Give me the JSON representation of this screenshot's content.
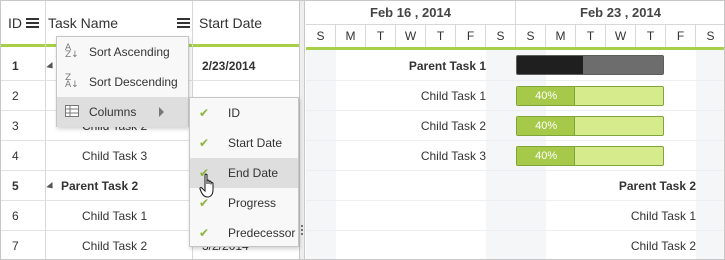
{
  "grid": {
    "columns": {
      "id": "ID",
      "task_name": "Task Name",
      "start_date": "Start Date"
    },
    "rows": [
      {
        "id": "1",
        "name": "",
        "start": "2/23/2014",
        "bold": true
      },
      {
        "id": "2",
        "name": "",
        "start": "",
        "bold": false
      },
      {
        "id": "3",
        "name": "Child Task 2",
        "start": "",
        "bold": false
      },
      {
        "id": "4",
        "name": "Child Task 3",
        "start": "",
        "bold": false
      },
      {
        "id": "5",
        "name": "Parent Task 2",
        "start": "",
        "bold": true
      },
      {
        "id": "6",
        "name": "Child Task 1",
        "start": "",
        "bold": false
      },
      {
        "id": "7",
        "name": "Child Task 2",
        "start": "3/2/2014",
        "bold": false
      }
    ]
  },
  "context_menu": {
    "items": [
      {
        "label": "Sort Ascending",
        "icon": "sort-ascending-icon"
      },
      {
        "label": "Sort Descending",
        "icon": "sort-descending-icon"
      },
      {
        "label": "Columns",
        "icon": "columns-icon"
      }
    ]
  },
  "columns_submenu": {
    "items": [
      {
        "label": "ID",
        "checked": true
      },
      {
        "label": "Start Date",
        "checked": true
      },
      {
        "label": "End Date",
        "checked": true
      },
      {
        "label": "Progress",
        "checked": true
      },
      {
        "label": "Predecessor",
        "checked": true
      }
    ]
  },
  "timeline": {
    "weeks": [
      "Feb 16 , 2014",
      "Feb 23 , 2014"
    ],
    "days": [
      "S",
      "M",
      "T",
      "W",
      "T",
      "F",
      "S",
      "S",
      "M",
      "T",
      "W",
      "T",
      "F",
      "S"
    ]
  },
  "chart_rows": [
    {
      "label": "Parent Task 1",
      "bold": true,
      "bar": "parent",
      "progress": 0.45
    },
    {
      "label": "Child Task 1",
      "bold": false,
      "bar": "task",
      "progress": 0.4,
      "progress_text": "40%"
    },
    {
      "label": "Child Task 2",
      "bold": false,
      "bar": "task",
      "progress": 0.4,
      "progress_text": "40%"
    },
    {
      "label": "Child Task 3",
      "bold": false,
      "bar": "task",
      "progress": 0.4,
      "progress_text": "40%"
    },
    {
      "label": "Parent Task 2",
      "bold": true,
      "bar": "none"
    },
    {
      "label": "Child Task 1",
      "bold": false,
      "bar": "none"
    },
    {
      "label": "Child Task 2",
      "bold": false,
      "bar": "none"
    }
  ],
  "colors": {
    "accent": "#a7cf48",
    "parent_bar_done": "#1f1f1f",
    "parent_bar_remaining": "#6d6d6d",
    "task_bar_done": "#a7c94a",
    "task_bar_remaining": "#d6ec8c",
    "check": "#8bb43a"
  }
}
